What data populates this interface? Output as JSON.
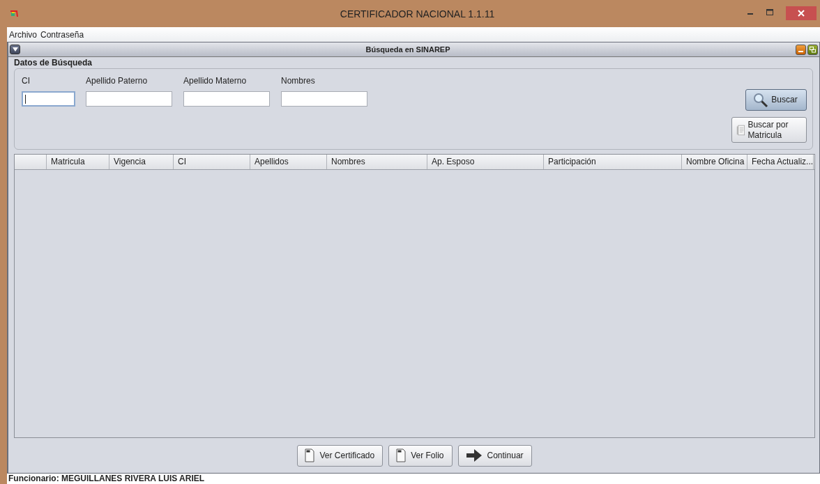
{
  "window": {
    "title": "CERTIFICADOR NACIONAL 1.1.11"
  },
  "menu": [
    "Archivo",
    "Contraseña"
  ],
  "frame": {
    "title": "Búsqueda en SINAREP"
  },
  "search": {
    "title": "Datos de Búsqueda",
    "fields": [
      {
        "label": "CI",
        "focused": true
      },
      {
        "label": "Apellido Paterno",
        "focused": false
      },
      {
        "label": "Apellido Materno",
        "focused": false
      },
      {
        "label": "Nombres",
        "focused": false
      }
    ],
    "buttons": [
      {
        "kind": "search",
        "label": "Buscar"
      },
      {
        "kind": "book",
        "label": "Buscar por Matricula"
      }
    ]
  },
  "table": {
    "columns": [
      "",
      "Matricula",
      "Vigencia",
      "CI",
      "Apellidos",
      "Nombres",
      "Ap. Esposo",
      "Participación",
      "Nombre Oficina",
      "Fecha Actualiz..."
    ]
  },
  "buttons": [
    {
      "kind": "doc",
      "label": "Ver Certificado"
    },
    {
      "kind": "doc",
      "label": "Ver Folio"
    },
    {
      "kind": "arrow",
      "label": "Continuar"
    }
  ],
  "status_bar": "Funcionario: MEGUILLANES RIVERA LUIS ARIEL"
}
